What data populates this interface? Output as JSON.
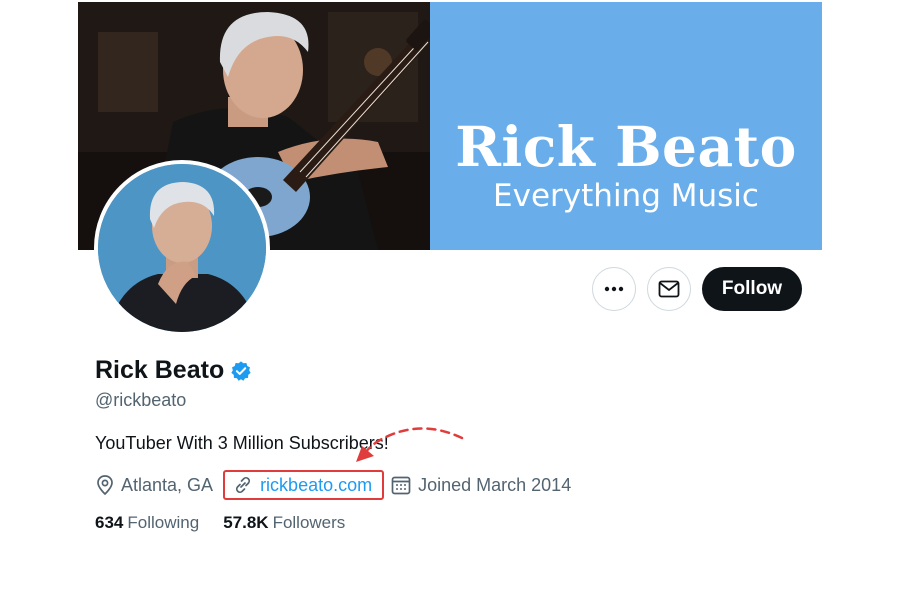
{
  "banner": {
    "brand_title": "Rick Beato",
    "brand_subtitle": "Everything Music",
    "brand_color": "#69aeea"
  },
  "profile": {
    "display_name": "Rick Beato",
    "verified": true,
    "handle": "@rickbeato",
    "bio": "YouTuber With 3 Million Subscribers!",
    "location": "Atlanta, GA",
    "website": "rickbeato.com",
    "joined": "Joined March 2014"
  },
  "stats": {
    "following_count": "634",
    "following_label": "Following",
    "followers_count": "57.8K",
    "followers_label": "Followers"
  },
  "actions": {
    "more_icon": "more-horizontal-icon",
    "message_icon": "envelope-icon",
    "follow_label": "Follow"
  },
  "annotation": {
    "color": "#e03c3c",
    "target": "website-link"
  },
  "colors": {
    "link": "#1d9bf0",
    "text": "#0f1419",
    "muted": "#536471",
    "verified": "#1d9bf0"
  }
}
